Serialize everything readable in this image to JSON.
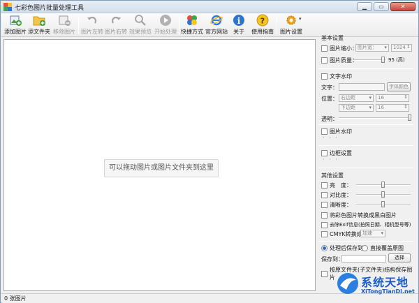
{
  "window": {
    "title": "七彩色图片批量处理工具"
  },
  "toolbar": [
    {
      "label": "添加图片",
      "icon": "add-image-icon",
      "enabled": true
    },
    {
      "label": "添文件夹",
      "icon": "add-folder-icon",
      "enabled": true
    },
    {
      "label": "移除图片",
      "icon": "remove-image-icon",
      "enabled": false
    },
    {
      "label": "图片左转",
      "icon": "rotate-left-icon",
      "enabled": false
    },
    {
      "label": "图片右转",
      "icon": "rotate-right-icon",
      "enabled": false
    },
    {
      "label": "效果预览",
      "icon": "preview-icon",
      "enabled": false
    },
    {
      "label": "开始处理",
      "icon": "play-icon",
      "enabled": false
    },
    {
      "label": "快捷方式",
      "icon": "shortcut-icon",
      "enabled": true
    },
    {
      "label": "官方网站",
      "icon": "ie-icon",
      "enabled": true
    },
    {
      "label": "关于",
      "icon": "info-icon",
      "enabled": true
    },
    {
      "label": "使用指南",
      "icon": "help-icon",
      "enabled": true
    },
    {
      "label": "图片设置",
      "icon": "settings-gear-icon",
      "enabled": true
    }
  ],
  "canvas": {
    "hint": "可以拖动图片或图片文件夹到这里"
  },
  "panel": {
    "basic_title": "基本设置",
    "resize_label": "图片缩小：",
    "resize_mode": "图片宽：",
    "resize_value": "1024",
    "quality_label": "图片质量：",
    "quality_value": "95 (高)",
    "quality_level_percent": 95,
    "text_wm_title": "文字水印",
    "text_label": "文字：",
    "font_color_button": "字体颜色",
    "position_label": "位置：",
    "pos_h": "右边距",
    "pos_h_value": "16",
    "pos_v": "下边距",
    "pos_v_value": "16",
    "opacity_label": "透明：",
    "image_wm_title": "图片水印",
    "border_title": "边框设置",
    "dots": "· · ·",
    "other_title": "其他设置",
    "brightness": "亮　度：",
    "contrast": "对比度：",
    "sharpness": "清晰度：",
    "grayscale": "将彩色图片转换成黑白图片",
    "exif": "去除Exif信息(拍照日期、相机型号等)",
    "cmyk_label": "CMYK转换成：",
    "cmyk_value": "加速",
    "save_after": "处理后保存到",
    "overwrite": "直接覆盖原图",
    "save_to": "保存到：",
    "browse": "选择",
    "keep_structure": "按原文件夹(子文件夹)结构保存图片"
  },
  "status": {
    "count": "0 张图片"
  },
  "watermark": {
    "brand": "系统天地",
    "url": "XiTongTianDi.net"
  },
  "colors": {
    "accent": "#1a5cc4"
  }
}
